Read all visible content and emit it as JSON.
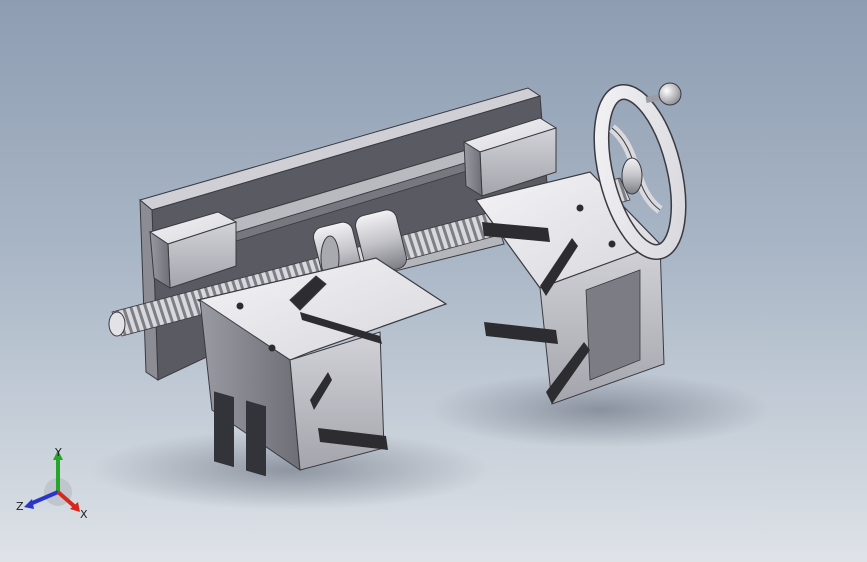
{
  "viewport": {
    "background_top": "#8e9db2",
    "background_bottom": "#dfe3e8"
  },
  "model": {
    "part_light": "#e9e9ee",
    "part_mid": "#c9c9d0",
    "part_dark": "#8c8c94",
    "part_edge": "#3a3a40",
    "jaw_pad": "#2d2d31",
    "plate_dark": "#4a4a50"
  },
  "triad": {
    "x_label": "X",
    "y_label": "Y",
    "z_label": "Z",
    "x_color": "#d9261c",
    "y_color": "#25a52a",
    "z_color": "#2a35c9"
  }
}
